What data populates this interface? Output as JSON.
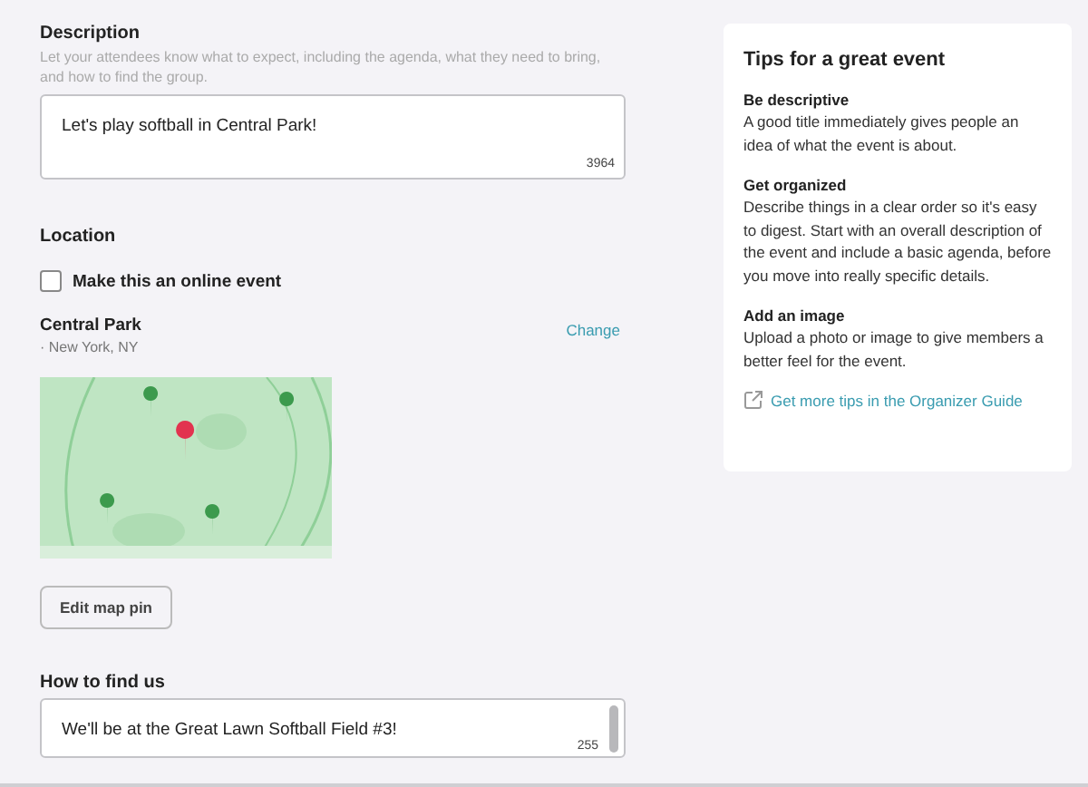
{
  "description": {
    "label": "Description",
    "hint": "Let your attendees know what to expect, including the agenda, what they need to bring, and how to find the group.",
    "value": "Let's play softball in Central Park!",
    "counter": "3964"
  },
  "location": {
    "heading": "Location",
    "online_checkbox": {
      "label": "Make this an online event",
      "checked": false
    },
    "venue_name": "Central Park",
    "venue_address": "· New York, NY",
    "change_link": "Change",
    "edit_button": "Edit map pin"
  },
  "how_to_find": {
    "label": "How to find us",
    "value": "We'll be at the Great Lawn Softball Field #3!",
    "counter": "255"
  },
  "tips": {
    "title": "Tips for a great event",
    "items": [
      {
        "heading": "Be descriptive",
        "body": "A good title immediately gives people an idea of what the event is about."
      },
      {
        "heading": "Get organized",
        "body": "Describe things in a clear order so it's easy to digest. Start with an overall description of the event and include a basic agenda, before you move into really specific details."
      },
      {
        "heading": "Add an image",
        "body": "Upload a photo or image to give members a better feel for the event."
      }
    ],
    "link": "Get more tips in the Organizer Guide"
  }
}
